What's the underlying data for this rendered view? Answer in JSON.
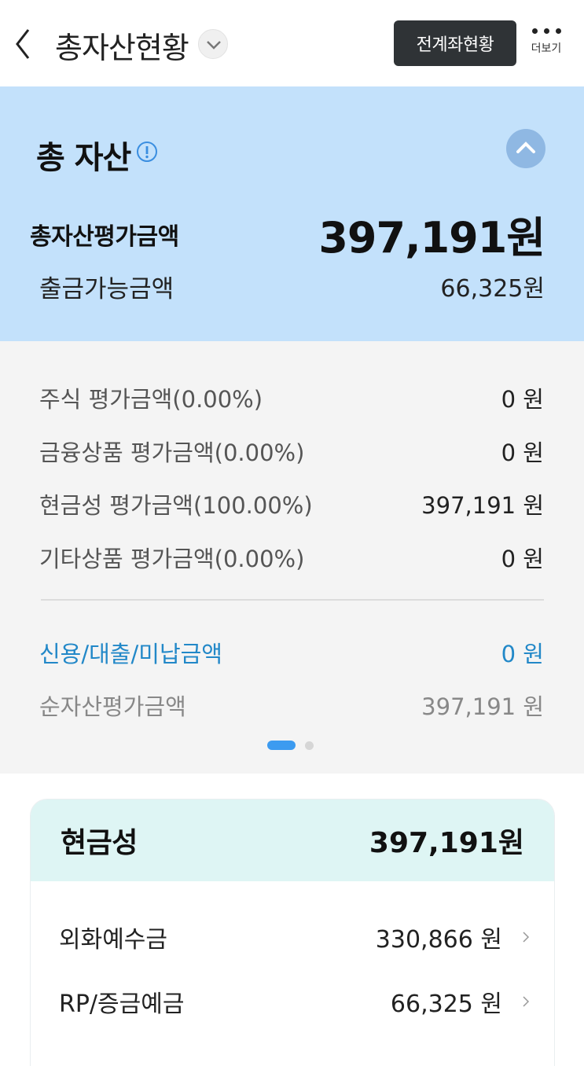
{
  "header": {
    "title": "총자산현황",
    "all_accounts_button": "전계좌현황",
    "more_label": "더보기"
  },
  "summary": {
    "title": "총 자산",
    "total_eval_label": "총자산평가금액",
    "total_eval_value": "397,191원",
    "withdrawable_label": "출금가능금액",
    "withdrawable_value": "66,325원"
  },
  "breakdown": {
    "rows": [
      {
        "label": "주식 평가금액(0.00%)",
        "value": "0 원"
      },
      {
        "label": "금융상품 평가금액(0.00%)",
        "value": "0 원"
      },
      {
        "label": "현금성 평가금액(100.00%)",
        "value": "397,191 원"
      },
      {
        "label": "기타상품 평가금액(0.00%)",
        "value": "0 원"
      }
    ],
    "credit": {
      "label": "신용/대출/미납금액",
      "value": "0 원"
    },
    "net": {
      "label": "순자산평가금액",
      "value": "397,191 원"
    }
  },
  "pager": {
    "current": 1,
    "total": 2
  },
  "cash_card": {
    "title": "현금성",
    "total": "397,191원",
    "items": [
      {
        "label": "외화예수금",
        "value": "330,866 원"
      },
      {
        "label": "RP/증금예금",
        "value": "66,325 원"
      }
    ]
  },
  "colors": {
    "summary_bg": "#c3e1fb",
    "breakdown_bg": "#f4f4f4",
    "credit_blue": "#2288c8",
    "card_header_bg": "#def5f4",
    "button_dark": "#2f3336"
  },
  "icons": {
    "back": "chevron-left-icon",
    "title_dropdown": "chevron-down-icon",
    "more": "more-dots-icon",
    "info": "info-icon",
    "collapse": "chevron-up-icon",
    "row_arrow": "chevron-right-icon"
  }
}
